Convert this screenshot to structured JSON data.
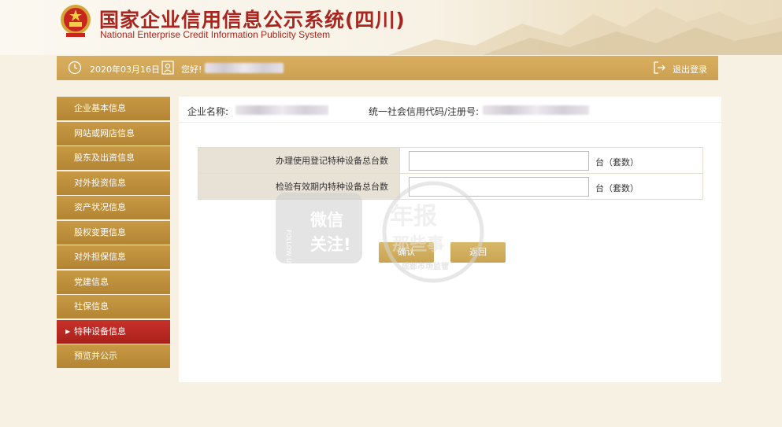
{
  "header": {
    "title_cn": "国家企业信用信息公示系统(四川)",
    "title_en": "National Enterprise Credit Information Publicity System"
  },
  "topbar": {
    "date": "2020年03月16日",
    "greeting": "您好!",
    "logout": "退出登录"
  },
  "sidebar": {
    "items": [
      {
        "label": "企业基本信息"
      },
      {
        "label": "网站或网店信息"
      },
      {
        "label": "股东及出资信息"
      },
      {
        "label": "对外投资信息"
      },
      {
        "label": "资产状况信息"
      },
      {
        "label": "股权变更信息"
      },
      {
        "label": "对外担保信息"
      },
      {
        "label": "党建信息"
      },
      {
        "label": "社保信息"
      },
      {
        "label": "特种设备信息"
      },
      {
        "label": "预览并公示"
      }
    ],
    "active_index": 9
  },
  "company": {
    "name_label": "企业名称:",
    "code_label": "统一社会信用代码/注册号:"
  },
  "form": {
    "rows": [
      {
        "label": "办理使用登记特种设备总台数",
        "value": "",
        "unit": "台（套数）"
      },
      {
        "label": "检验有效期内特种设备总台数",
        "value": "",
        "unit": "台（套数）"
      }
    ],
    "confirm": "确认",
    "back": "返回"
  },
  "watermark": {
    "line1": "微信",
    "line2": "关注!",
    "side": "FOLLOW US",
    "stamp1": "年报",
    "stamp2": "那些事",
    "stamp3": "成都市场监管"
  },
  "colors": {
    "brand_red": "#a8261f",
    "gold": "#c89a44",
    "active_red": "#b8271f"
  }
}
